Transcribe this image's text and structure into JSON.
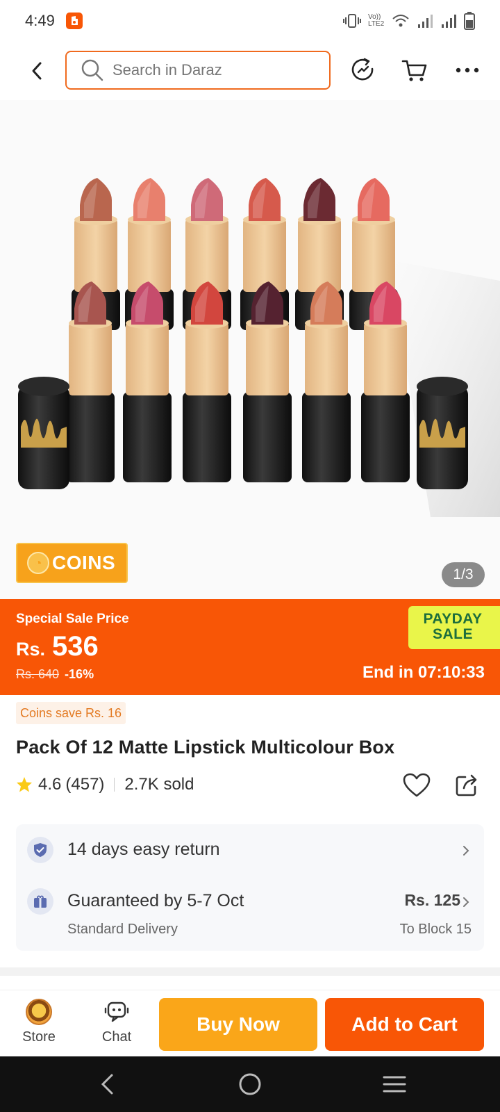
{
  "status_bar": {
    "time": "4:49",
    "network_label": "Vo)) LTE2"
  },
  "header": {
    "search_placeholder": "Search in Daraz"
  },
  "gallery": {
    "coins_label": "COINS",
    "page_indicator": "1/3"
  },
  "sale": {
    "title": "Special Sale Price",
    "currency": "Rs.",
    "price": "536",
    "original_price": "Rs. 640",
    "discount": "-16%",
    "campaign_line1": "PAYDAY",
    "campaign_line2": "SALE",
    "end_timer": "End in 07:10:33"
  },
  "product": {
    "coins_save": "Coins save Rs. 16",
    "title": "Pack Of 12 Matte Lipstick Multicolour Box",
    "rating": "4.6",
    "reviews": "(457)",
    "sold": "2.7K sold"
  },
  "services": {
    "return_text": "14 days easy return",
    "delivery_text": "Guaranteed by 5-7 Oct",
    "delivery_sub": "Standard Delivery",
    "delivery_fee": "Rs. 125",
    "delivery_location": "To Block 15"
  },
  "action_bar": {
    "store_label": "Store",
    "chat_label": "Chat",
    "buy_now_label": "Buy Now",
    "add_to_cart_label": "Add to Cart"
  },
  "colors": {
    "brand_orange": "#f85606",
    "buy_now_yellow": "#faa619",
    "payday_green": "#e9f54a"
  },
  "lipstick_shades": [
    "#b9664e",
    "#e8806d",
    "#cf6a78",
    "#d65a4c",
    "#6b2a32",
    "#e66a60",
    "#a8554f",
    "#c64c6c",
    "#d2463e",
    "#552230",
    "#d57c5a",
    "#d94763"
  ]
}
